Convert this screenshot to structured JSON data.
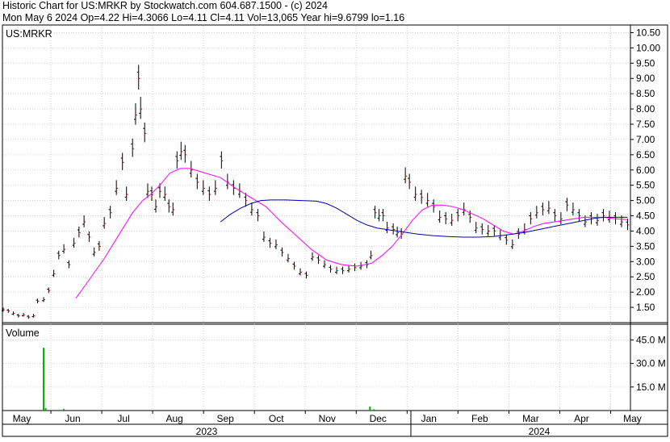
{
  "header": {
    "line1": "Historic Chart for US:MRKR by Stockwatch.com 604.687.1500 - (c) 2024",
    "line2": "Mon May  6 2024  Op=4.22  Hi=4.3066  Lo=4.11  Cl=4.11  Vol=13,065  Year hi=9.6799  lo=1.16"
  },
  "chart_data": {
    "type": "line",
    "title": "Historic Chart for US:MRKR by Stockwatch.com 604.687.1500 - (c) 2024",
    "symbol_label": "US:MRKR",
    "volume_label": "Volume",
    "price_axis": {
      "ticks": [
        "1.50",
        "2.00",
        "2.50",
        "3.00",
        "3.50",
        "4.00",
        "4.50",
        "5.00",
        "5.50",
        "6.00",
        "6.50",
        "7.00",
        "7.50",
        "8.00",
        "8.50",
        "9.00",
        "9.50",
        "10.00",
        "10.50"
      ],
      "ylim": [
        1.0,
        10.75
      ]
    },
    "volume_axis": {
      "ticks": [
        "15.0 M",
        "30.0 M",
        "45.0 M"
      ],
      "ylim": [
        0,
        55
      ]
    },
    "months": [
      "May",
      "Jun",
      "Jul",
      "Aug",
      "Sep",
      "Oct",
      "Nov",
      "Dec",
      "Jan",
      "Feb",
      "Mar",
      "Apr",
      "May"
    ],
    "years": [
      "2023",
      "2024"
    ],
    "grid": true,
    "series": [
      {
        "role": "price-bars",
        "color": "#000000",
        "points": [
          [
            0.0,
            1.42
          ],
          [
            0.5,
            1.38
          ],
          [
            1.0,
            1.3
          ],
          [
            1.5,
            1.22
          ],
          [
            2.0,
            1.25
          ],
          [
            2.5,
            1.18
          ],
          [
            3.0,
            1.22
          ],
          [
            3.4,
            1.7
          ],
          [
            4.0,
            1.75
          ],
          [
            4.5,
            2.05
          ],
          [
            5.0,
            2.6
          ],
          [
            5.5,
            3.2
          ],
          [
            6.0,
            3.4
          ],
          [
            6.5,
            2.9
          ],
          [
            7.0,
            3.6
          ],
          [
            7.5,
            3.95
          ],
          [
            8.0,
            4.3
          ],
          [
            8.5,
            3.8
          ],
          [
            9.0,
            3.3
          ],
          [
            9.5,
            3.5
          ],
          [
            10.0,
            4.25
          ],
          [
            10.6,
            4.6
          ],
          [
            11.2,
            5.4
          ],
          [
            11.8,
            6.25
          ],
          [
            12.2,
            5.2
          ],
          [
            12.8,
            6.7
          ],
          [
            13.1,
            7.8
          ],
          [
            13.4,
            9.0
          ],
          [
            13.6,
            8.0
          ],
          [
            14.0,
            7.2
          ],
          [
            14.3,
            5.3
          ],
          [
            14.7,
            5.2
          ],
          [
            15.1,
            4.8
          ],
          [
            15.5,
            5.3
          ],
          [
            16.0,
            5.2
          ],
          [
            16.4,
            4.8
          ],
          [
            16.8,
            4.7
          ],
          [
            17.2,
            6.3
          ],
          [
            17.6,
            6.6
          ],
          [
            18.0,
            6.5
          ],
          [
            18.6,
            6.0
          ],
          [
            19.2,
            5.6
          ],
          [
            19.8,
            5.4
          ],
          [
            20.4,
            5.2
          ],
          [
            21.0,
            5.4
          ],
          [
            21.6,
            6.3
          ],
          [
            22.2,
            5.6
          ],
          [
            22.8,
            5.4
          ],
          [
            23.4,
            5.3
          ],
          [
            24.0,
            5.0
          ],
          [
            24.6,
            4.7
          ],
          [
            25.2,
            4.5
          ],
          [
            25.8,
            3.8
          ],
          [
            26.4,
            3.6
          ],
          [
            27.0,
            3.55
          ],
          [
            27.6,
            3.3
          ],
          [
            28.2,
            3.1
          ],
          [
            28.8,
            2.85
          ],
          [
            29.4,
            2.65
          ],
          [
            30.0,
            2.55
          ],
          [
            30.6,
            3.15
          ],
          [
            31.2,
            3.05
          ],
          [
            31.8,
            2.9
          ],
          [
            32.4,
            2.75
          ],
          [
            33.0,
            2.7
          ],
          [
            33.6,
            2.7
          ],
          [
            34.2,
            2.75
          ],
          [
            34.8,
            2.8
          ],
          [
            35.4,
            2.85
          ],
          [
            36.0,
            2.9
          ],
          [
            36.4,
            3.2
          ],
          [
            36.8,
            4.6
          ],
          [
            37.2,
            4.5
          ],
          [
            37.6,
            4.5
          ],
          [
            38.0,
            4.1
          ],
          [
            38.6,
            4.05
          ],
          [
            39.0,
            3.95
          ],
          [
            39.4,
            3.9
          ],
          [
            39.8,
            5.8
          ],
          [
            40.2,
            5.6
          ],
          [
            40.8,
            5.2
          ],
          [
            41.4,
            5.1
          ],
          [
            42.0,
            5.0
          ],
          [
            42.6,
            4.8
          ],
          [
            43.2,
            4.45
          ],
          [
            43.8,
            4.4
          ],
          [
            44.4,
            4.35
          ],
          [
            45.0,
            4.5
          ],
          [
            45.6,
            4.7
          ],
          [
            46.2,
            4.45
          ],
          [
            46.8,
            4.1
          ],
          [
            47.4,
            4.05
          ],
          [
            48.0,
            4.0
          ],
          [
            48.6,
            4.0
          ],
          [
            49.2,
            3.85
          ],
          [
            49.8,
            3.7
          ],
          [
            50.4,
            3.55
          ],
          [
            51.0,
            3.9
          ],
          [
            51.6,
            4.05
          ],
          [
            52.2,
            4.4
          ],
          [
            52.8,
            4.6
          ],
          [
            53.4,
            4.7
          ],
          [
            54.0,
            4.75
          ],
          [
            54.6,
            4.5
          ],
          [
            55.2,
            4.4
          ],
          [
            55.8,
            4.85
          ],
          [
            56.4,
            4.7
          ],
          [
            57.0,
            4.5
          ],
          [
            57.6,
            4.3
          ],
          [
            58.2,
            4.4
          ],
          [
            58.8,
            4.35
          ],
          [
            59.4,
            4.5
          ],
          [
            60.0,
            4.45
          ],
          [
            60.6,
            4.4
          ],
          [
            61.2,
            4.3
          ],
          [
            61.8,
            4.2
          ]
        ]
      },
      {
        "role": "moving-average-short",
        "color": "#ff00ff",
        "points": [
          [
            7.2,
            1.8
          ],
          [
            8.5,
            2.4
          ],
          [
            10.0,
            3.1
          ],
          [
            11.5,
            3.9
          ],
          [
            12.8,
            4.6
          ],
          [
            13.8,
            5.0
          ],
          [
            14.6,
            5.2
          ],
          [
            15.5,
            5.5
          ],
          [
            16.5,
            5.9
          ],
          [
            17.5,
            6.05
          ],
          [
            18.5,
            6.05
          ],
          [
            20.0,
            5.9
          ],
          [
            21.5,
            5.75
          ],
          [
            23.0,
            5.4
          ],
          [
            24.5,
            5.1
          ],
          [
            26.0,
            4.8
          ],
          [
            27.5,
            4.3
          ],
          [
            29.0,
            3.85
          ],
          [
            30.5,
            3.4
          ],
          [
            32.0,
            3.05
          ],
          [
            33.5,
            2.9
          ],
          [
            35.0,
            2.85
          ],
          [
            36.5,
            2.95
          ],
          [
            37.5,
            3.2
          ],
          [
            38.5,
            3.5
          ],
          [
            39.5,
            3.9
          ],
          [
            40.5,
            4.35
          ],
          [
            41.5,
            4.7
          ],
          [
            42.5,
            4.85
          ],
          [
            43.5,
            4.85
          ],
          [
            44.5,
            4.8
          ],
          [
            45.5,
            4.7
          ],
          [
            46.5,
            4.55
          ],
          [
            47.5,
            4.4
          ],
          [
            48.5,
            4.2
          ],
          [
            49.5,
            4.0
          ],
          [
            50.5,
            3.9
          ],
          [
            51.5,
            4.0
          ],
          [
            52.5,
            4.15
          ],
          [
            53.5,
            4.25
          ],
          [
            54.5,
            4.3
          ],
          [
            55.5,
            4.35
          ],
          [
            56.5,
            4.4
          ],
          [
            57.5,
            4.45
          ],
          [
            58.5,
            4.45
          ],
          [
            59.5,
            4.45
          ],
          [
            60.5,
            4.4
          ],
          [
            61.8,
            4.38
          ]
        ]
      },
      {
        "role": "moving-average-long",
        "color": "#0000aa",
        "points": [
          [
            21.5,
            4.3
          ],
          [
            22.5,
            4.55
          ],
          [
            23.5,
            4.75
          ],
          [
            24.5,
            4.9
          ],
          [
            25.5,
            5.0
          ],
          [
            26.5,
            5.02
          ],
          [
            28.0,
            5.02
          ],
          [
            29.5,
            5.0
          ],
          [
            31.0,
            4.98
          ],
          [
            32.0,
            4.9
          ],
          [
            33.0,
            4.75
          ],
          [
            34.0,
            4.55
          ],
          [
            35.0,
            4.35
          ],
          [
            36.0,
            4.2
          ],
          [
            37.0,
            4.1
          ],
          [
            38.0,
            4.05
          ],
          [
            39.0,
            4.0
          ],
          [
            40.0,
            3.95
          ],
          [
            41.0,
            3.9
          ],
          [
            42.5,
            3.85
          ],
          [
            44.0,
            3.82
          ],
          [
            45.5,
            3.8
          ],
          [
            47.0,
            3.8
          ],
          [
            48.5,
            3.82
          ],
          [
            50.0,
            3.88
          ],
          [
            51.5,
            3.95
          ],
          [
            53.0,
            4.05
          ],
          [
            54.5,
            4.15
          ],
          [
            56.0,
            4.25
          ],
          [
            57.5,
            4.35
          ],
          [
            58.5,
            4.42
          ],
          [
            59.5,
            4.45
          ],
          [
            61.0,
            4.45
          ],
          [
            61.8,
            4.45
          ]
        ]
      },
      {
        "role": "volume",
        "color": "#00aa00",
        "points": [
          [
            4.0,
            40.0
          ],
          [
            4.2,
            1.5
          ],
          [
            6.0,
            1.0
          ],
          [
            36.3,
            2.5
          ],
          [
            36.7,
            0.8
          ]
        ]
      }
    ]
  }
}
